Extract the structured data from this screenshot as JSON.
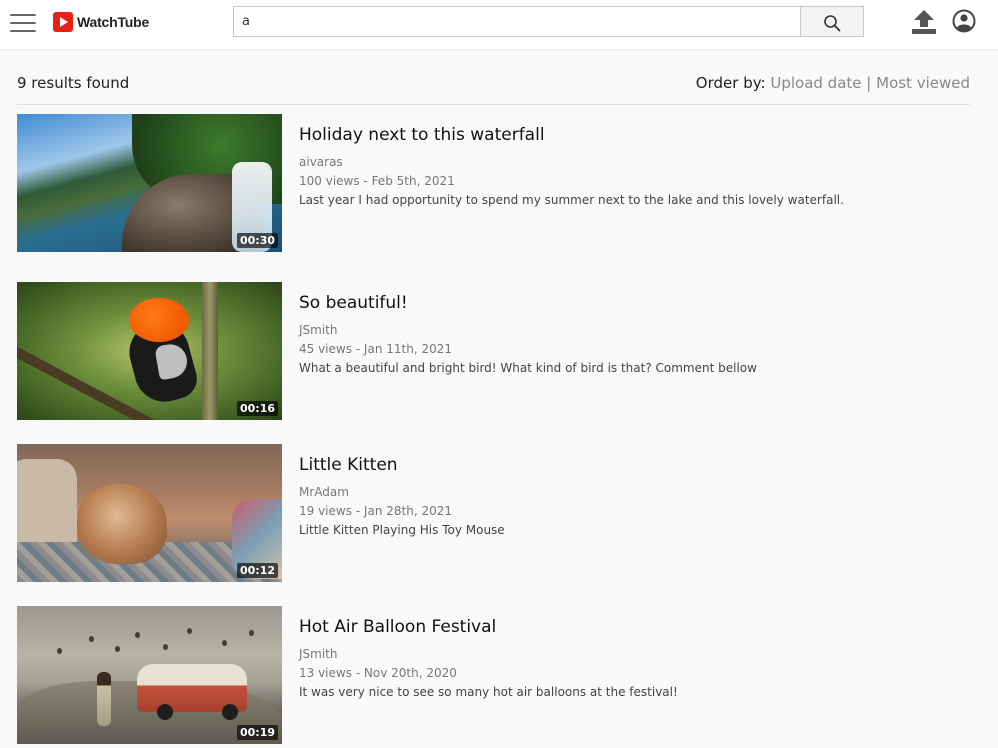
{
  "header": {
    "logo_text": "WatchTube",
    "search_value": "a",
    "icons": [
      "menu-icon",
      "search-icon",
      "upload-icon",
      "account-icon"
    ]
  },
  "results": {
    "count_text": "9 results found",
    "order_label": "Order by:",
    "order_options": [
      "Upload date",
      "Most viewed"
    ],
    "separator": "|"
  },
  "videos": [
    {
      "title": "Holiday next to this waterfall",
      "channel": "aivaras",
      "meta": "100 views - Feb 5th, 2021",
      "description": "Last year I had opportunity to spend my summer next to the lake and this lovely waterfall.",
      "duration": "00:30"
    },
    {
      "title": "So beautiful!",
      "channel": "JSmith",
      "meta": "45 views - Jan 11th, 2021",
      "description": "What a beautiful and bright bird! What kind of bird is that? Comment bellow",
      "duration": "00:16"
    },
    {
      "title": "Little Kitten",
      "channel": "MrAdam",
      "meta": "19 views - Jan 28th, 2021",
      "description": "Little Kitten Playing His Toy Mouse",
      "duration": "00:12"
    },
    {
      "title": "Hot Air Balloon Festival",
      "channel": "JSmith",
      "meta": "13 views - Nov 20th, 2020",
      "description": "It was very nice to see so many hot air balloons at the festival!",
      "duration": "00:19"
    }
  ],
  "colors": {
    "brand_red": "#e62117",
    "background": "#f9f9f9",
    "link_gray": "#888888"
  }
}
